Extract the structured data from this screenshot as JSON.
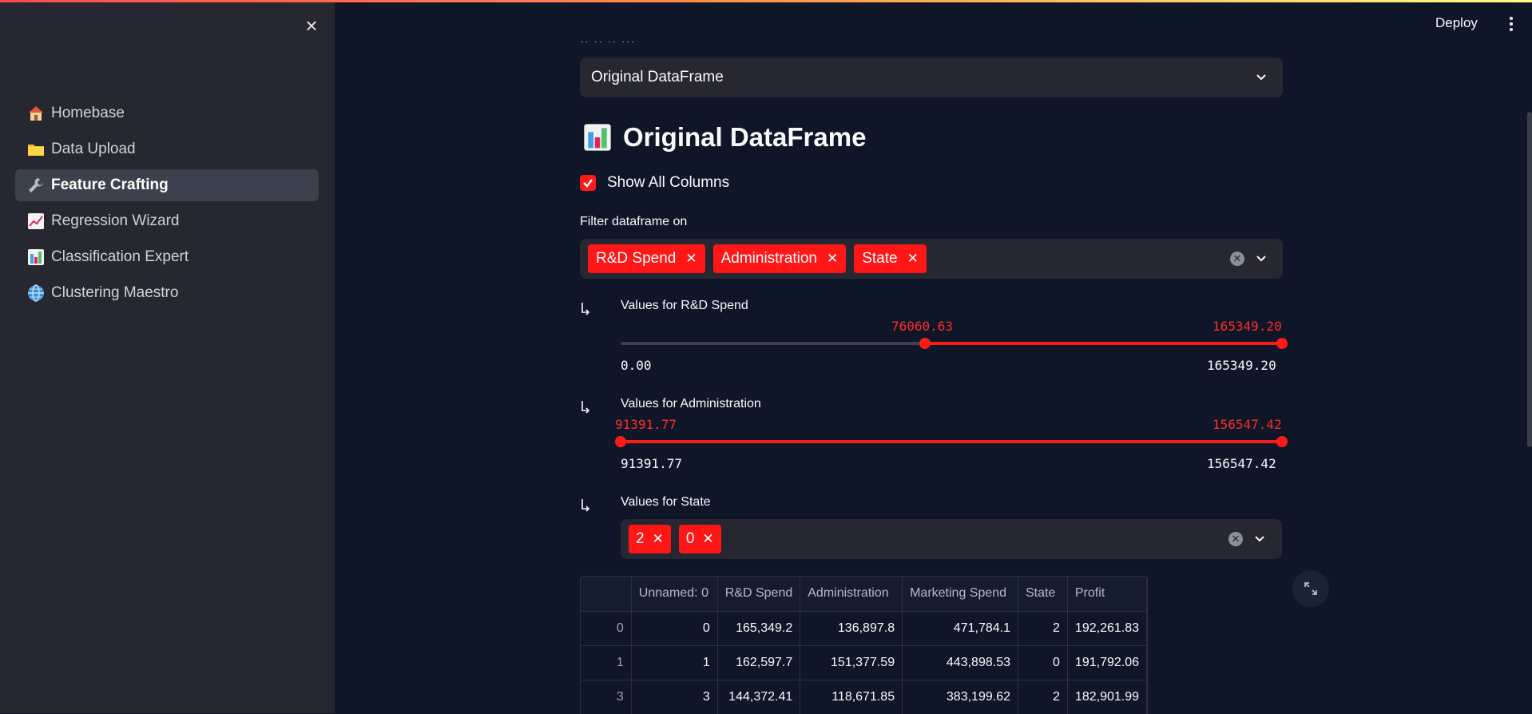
{
  "header": {
    "deploy_label": "Deploy"
  },
  "sidebar": {
    "close_icon": "close-icon",
    "items": [
      {
        "label": "Homebase",
        "icon": "house-icon",
        "active": false
      },
      {
        "label": "Data Upload",
        "icon": "folder-icon",
        "active": false
      },
      {
        "label": "Feature Crafting",
        "icon": "wrench-icon",
        "active": true
      },
      {
        "label": "Regression Wizard",
        "icon": "line-chart-icon",
        "active": false
      },
      {
        "label": "Classification Expert",
        "icon": "bar-chart-icon",
        "active": false
      },
      {
        "label": "Clustering Maestro",
        "icon": "globe-icon",
        "active": false
      }
    ]
  },
  "main": {
    "view_select": {
      "value": "Original DataFrame"
    },
    "title": "Original DataFrame",
    "show_all": {
      "label": "Show All Columns",
      "checked": true
    },
    "filter": {
      "label": "Filter dataframe on",
      "tags": [
        "R&D Spend",
        "Administration",
        "State"
      ]
    },
    "rd_slider": {
      "label": "Values for R&D Spend",
      "low": "76060.63",
      "high": "165349.20",
      "min": "0.00",
      "max": "165349.20",
      "low_fraction": 0.46,
      "high_fraction": 1.0
    },
    "admin_slider": {
      "label": "Values for Administration",
      "low": "91391.77",
      "high": "156547.42",
      "min": "91391.77",
      "max": "156547.42",
      "low_fraction": 0.0,
      "high_fraction": 1.0
    },
    "state_filter": {
      "label": "Values for State",
      "tags": [
        "2",
        "0"
      ]
    },
    "table": {
      "columns": [
        "",
        "Unnamed: 0",
        "R&D Spend",
        "Administration",
        "Marketing Spend",
        "State",
        "Profit"
      ],
      "rows": [
        [
          "0",
          "0",
          "165,349.2",
          "136,897.8",
          "471,784.1",
          "2",
          "192,261.83"
        ],
        [
          "1",
          "1",
          "162,597.7",
          "151,377.59",
          "443,898.53",
          "0",
          "191,792.06"
        ],
        [
          "3",
          "3",
          "144,372.41",
          "118,671.85",
          "383,199.62",
          "2",
          "182,901.99"
        ]
      ]
    }
  },
  "colors": {
    "accent": "#ff1a1a",
    "background": "#0e1628",
    "sidebar": "#262730"
  }
}
